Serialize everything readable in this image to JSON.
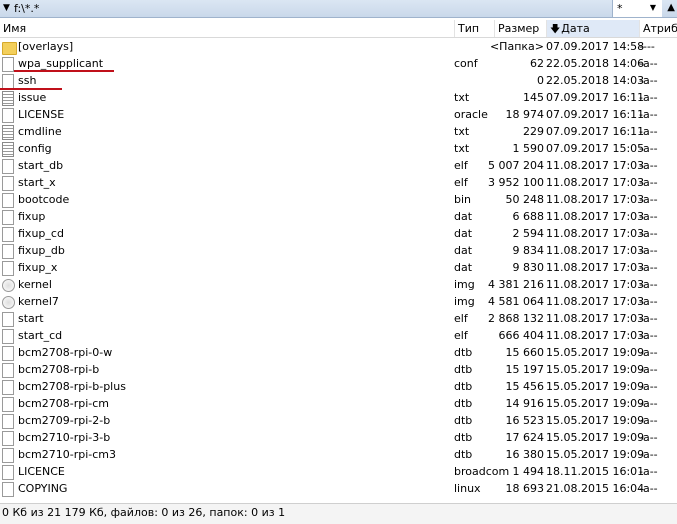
{
  "pathbar": {
    "path": "f:\\*.*",
    "filter": "*"
  },
  "columns": {
    "name": "Имя",
    "type": "Тип",
    "size": "Размер",
    "date": "Дата",
    "attr": "Атриб"
  },
  "files": [
    {
      "name": "[overlays]",
      "type": "",
      "size": "<Папка>",
      "date": "07.09.2017 14:58",
      "attr": "----",
      "icon": "folder-icon"
    },
    {
      "name": "wpa_supplicant",
      "type": "conf",
      "size": "62",
      "date": "22.05.2018 14:06",
      "attr": "-a--",
      "icon": "file-icon"
    },
    {
      "name": "ssh",
      "type": "",
      "size": "0",
      "date": "22.05.2018 14:03",
      "attr": "-a--",
      "icon": "file-icon"
    },
    {
      "name": "issue",
      "type": "txt",
      "size": "145",
      "date": "07.09.2017 16:11",
      "attr": "-a--",
      "icon": "text-file-icon"
    },
    {
      "name": "LICENSE",
      "type": "oracle",
      "size": "18 974",
      "date": "07.09.2017 16:11",
      "attr": "-a--",
      "icon": "file-icon"
    },
    {
      "name": "cmdline",
      "type": "txt",
      "size": "229",
      "date": "07.09.2017 16:11",
      "attr": "-a--",
      "icon": "text-file-icon"
    },
    {
      "name": "config",
      "type": "txt",
      "size": "1 590",
      "date": "07.09.2017 15:05",
      "attr": "-a--",
      "icon": "text-file-icon"
    },
    {
      "name": "start_db",
      "type": "elf",
      "size": "5 007 204",
      "date": "11.08.2017 17:03",
      "attr": "-a--",
      "icon": "file-icon"
    },
    {
      "name": "start_x",
      "type": "elf",
      "size": "3 952 100",
      "date": "11.08.2017 17:03",
      "attr": "-a--",
      "icon": "file-icon"
    },
    {
      "name": "bootcode",
      "type": "bin",
      "size": "50 248",
      "date": "11.08.2017 17:03",
      "attr": "-a--",
      "icon": "file-icon"
    },
    {
      "name": "fixup",
      "type": "dat",
      "size": "6 688",
      "date": "11.08.2017 17:03",
      "attr": "-a--",
      "icon": "file-icon"
    },
    {
      "name": "fixup_cd",
      "type": "dat",
      "size": "2 594",
      "date": "11.08.2017 17:03",
      "attr": "-a--",
      "icon": "file-icon"
    },
    {
      "name": "fixup_db",
      "type": "dat",
      "size": "9 834",
      "date": "11.08.2017 17:03",
      "attr": "-a--",
      "icon": "file-icon"
    },
    {
      "name": "fixup_x",
      "type": "dat",
      "size": "9 830",
      "date": "11.08.2017 17:03",
      "attr": "-a--",
      "icon": "file-icon"
    },
    {
      "name": "kernel",
      "type": "img",
      "size": "4 381 216",
      "date": "11.08.2017 17:03",
      "attr": "-a--",
      "icon": "disk-image-icon"
    },
    {
      "name": "kernel7",
      "type": "img",
      "size": "4 581 064",
      "date": "11.08.2017 17:03",
      "attr": "-a--",
      "icon": "disk-image-icon"
    },
    {
      "name": "start",
      "type": "elf",
      "size": "2 868 132",
      "date": "11.08.2017 17:03",
      "attr": "-a--",
      "icon": "file-icon"
    },
    {
      "name": "start_cd",
      "type": "elf",
      "size": "666 404",
      "date": "11.08.2017 17:03",
      "attr": "-a--",
      "icon": "file-icon"
    },
    {
      "name": "bcm2708-rpi-0-w",
      "type": "dtb",
      "size": "15 660",
      "date": "15.05.2017 19:09",
      "attr": "-a--",
      "icon": "file-icon"
    },
    {
      "name": "bcm2708-rpi-b",
      "type": "dtb",
      "size": "15 197",
      "date": "15.05.2017 19:09",
      "attr": "-a--",
      "icon": "file-icon"
    },
    {
      "name": "bcm2708-rpi-b-plus",
      "type": "dtb",
      "size": "15 456",
      "date": "15.05.2017 19:09",
      "attr": "-a--",
      "icon": "file-icon"
    },
    {
      "name": "bcm2708-rpi-cm",
      "type": "dtb",
      "size": "14 916",
      "date": "15.05.2017 19:09",
      "attr": "-a--",
      "icon": "file-icon"
    },
    {
      "name": "bcm2709-rpi-2-b",
      "type": "dtb",
      "size": "16 523",
      "date": "15.05.2017 19:09",
      "attr": "-a--",
      "icon": "file-icon"
    },
    {
      "name": "bcm2710-rpi-3-b",
      "type": "dtb",
      "size": "17 624",
      "date": "15.05.2017 19:09",
      "attr": "-a--",
      "icon": "file-icon"
    },
    {
      "name": "bcm2710-rpi-cm3",
      "type": "dtb",
      "size": "16 380",
      "date": "15.05.2017 19:09",
      "attr": "-a--",
      "icon": "file-icon"
    },
    {
      "name": "LICENCE",
      "type": "broadcom",
      "size": "1 494",
      "date": "18.11.2015 16:01",
      "attr": "-a--",
      "icon": "file-icon"
    },
    {
      "name": "COPYING",
      "type": "linux",
      "size": "18 693",
      "date": "21.08.2015 16:04",
      "attr": "-a--",
      "icon": "file-icon"
    }
  ],
  "status": "0 Кб из 21 179 Кб, файлов: 0 из 26, папок: 0 из 1",
  "colors": {
    "highlight_line": "#c0101a",
    "header_bar": "#dbe6f3"
  }
}
